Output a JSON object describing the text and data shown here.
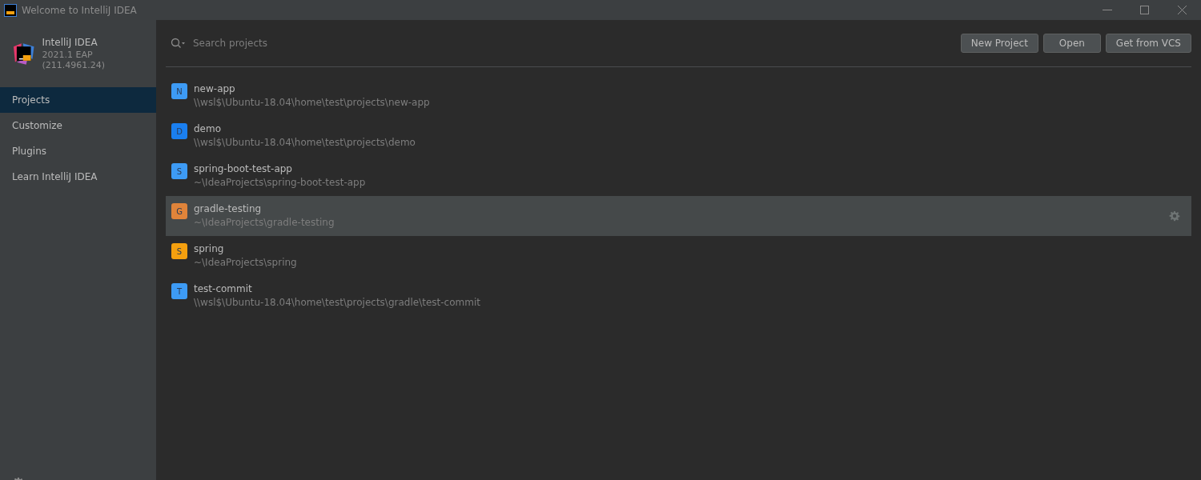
{
  "window": {
    "title": "Welcome to IntelliJ IDEA"
  },
  "product": {
    "name": "IntelliJ IDEA",
    "version": "2021.1 EAP (211.4961.24)"
  },
  "sidebar": {
    "items": [
      {
        "label": "Projects",
        "selected": true
      },
      {
        "label": "Customize",
        "selected": false
      },
      {
        "label": "Plugins",
        "selected": false
      },
      {
        "label": "Learn IntelliJ IDEA",
        "selected": false
      }
    ]
  },
  "search": {
    "placeholder": "Search projects"
  },
  "buttons": [
    "New Project",
    "Open",
    "Get from VCS"
  ],
  "projects": [
    {
      "letter": "N",
      "name": "new-app",
      "path": "\\\\wsl$\\Ubuntu-18.04\\home\\test\\projects\\new-app",
      "color": "#3d9bf5",
      "selected": false
    },
    {
      "letter": "D",
      "name": "demo",
      "path": "\\\\wsl$\\Ubuntu-18.04\\home\\test\\projects\\demo",
      "color": "#1a7ff0",
      "selected": false
    },
    {
      "letter": "S",
      "name": "spring-boot-test-app",
      "path": "~\\IdeaProjects\\spring-boot-test-app",
      "color": "#3d9bf5",
      "selected": false
    },
    {
      "letter": "G",
      "name": "gradle-testing",
      "path": "~\\IdeaProjects\\gradle-testing",
      "color": "#e0843a",
      "selected": true
    },
    {
      "letter": "S",
      "name": "spring",
      "path": "~\\IdeaProjects\\spring",
      "color": "#f5a00f",
      "selected": false
    },
    {
      "letter": "T",
      "name": "test-commit",
      "path": "\\\\wsl$\\Ubuntu-18.04\\home\\test\\projects\\gradle\\test-commit",
      "color": "#3d9bf5",
      "selected": false
    }
  ]
}
